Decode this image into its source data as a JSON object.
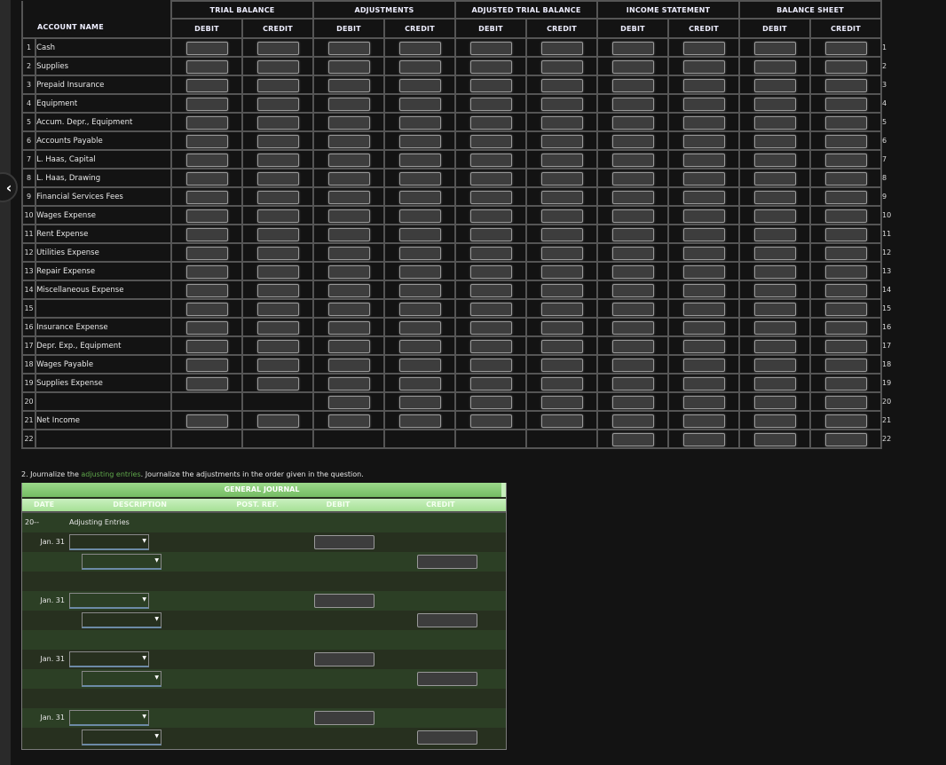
{
  "nav": {
    "back_icon": "‹"
  },
  "worksheet": {
    "account_header": "ACCOUNT NAME",
    "groups": [
      "TRIAL BALANCE",
      "ADJUSTMENTS",
      "ADJUSTED TRIAL BALANCE",
      "INCOME STATEMENT",
      "BALANCE SHEET"
    ],
    "debit_label": "DEBIT",
    "credit_label": "CREDIT",
    "rows": [
      {
        "num": "1",
        "name": "Cash",
        "inputs": [
          1,
          1,
          1,
          1,
          1,
          1,
          1,
          1,
          1,
          1
        ]
      },
      {
        "num": "2",
        "name": "Supplies",
        "inputs": [
          1,
          1,
          1,
          1,
          1,
          1,
          1,
          1,
          1,
          1
        ]
      },
      {
        "num": "3",
        "name": "Prepaid Insurance",
        "inputs": [
          1,
          1,
          1,
          1,
          1,
          1,
          1,
          1,
          1,
          1
        ]
      },
      {
        "num": "4",
        "name": "Equipment",
        "inputs": [
          1,
          1,
          1,
          1,
          1,
          1,
          1,
          1,
          1,
          1
        ]
      },
      {
        "num": "5",
        "name": "Accum. Depr., Equipment",
        "inputs": [
          1,
          1,
          1,
          1,
          1,
          1,
          1,
          1,
          1,
          1
        ]
      },
      {
        "num": "6",
        "name": "Accounts Payable",
        "inputs": [
          1,
          1,
          1,
          1,
          1,
          1,
          1,
          1,
          1,
          1
        ]
      },
      {
        "num": "7",
        "name": "L. Haas, Capital",
        "inputs": [
          1,
          1,
          1,
          1,
          1,
          1,
          1,
          1,
          1,
          1
        ]
      },
      {
        "num": "8",
        "name": "L. Haas, Drawing",
        "inputs": [
          1,
          1,
          1,
          1,
          1,
          1,
          1,
          1,
          1,
          1
        ]
      },
      {
        "num": "9",
        "name": "Financial Services Fees",
        "inputs": [
          1,
          1,
          1,
          1,
          1,
          1,
          1,
          1,
          1,
          1
        ]
      },
      {
        "num": "10",
        "name": "Wages Expense",
        "inputs": [
          1,
          1,
          1,
          1,
          1,
          1,
          1,
          1,
          1,
          1
        ]
      },
      {
        "num": "11",
        "name": "Rent Expense",
        "inputs": [
          1,
          1,
          1,
          1,
          1,
          1,
          1,
          1,
          1,
          1
        ]
      },
      {
        "num": "12",
        "name": "Utilities Expense",
        "inputs": [
          1,
          1,
          1,
          1,
          1,
          1,
          1,
          1,
          1,
          1
        ]
      },
      {
        "num": "13",
        "name": "Repair Expense",
        "inputs": [
          1,
          1,
          1,
          1,
          1,
          1,
          1,
          1,
          1,
          1
        ]
      },
      {
        "num": "14",
        "name": "Miscellaneous Expense",
        "inputs": [
          1,
          1,
          1,
          1,
          1,
          1,
          1,
          1,
          1,
          1
        ]
      },
      {
        "num": "15",
        "name": "",
        "inputs": [
          1,
          1,
          1,
          1,
          1,
          1,
          1,
          1,
          1,
          1
        ]
      },
      {
        "num": "16",
        "name": "Insurance Expense",
        "inputs": [
          1,
          1,
          1,
          1,
          1,
          1,
          1,
          1,
          1,
          1
        ]
      },
      {
        "num": "17",
        "name": "Depr. Exp., Equipment",
        "inputs": [
          1,
          1,
          1,
          1,
          1,
          1,
          1,
          1,
          1,
          1
        ]
      },
      {
        "num": "18",
        "name": "Wages Payable",
        "inputs": [
          1,
          1,
          1,
          1,
          1,
          1,
          1,
          1,
          1,
          1
        ]
      },
      {
        "num": "19",
        "name": "Supplies Expense",
        "inputs": [
          1,
          1,
          1,
          1,
          1,
          1,
          1,
          1,
          1,
          1
        ]
      },
      {
        "num": "20",
        "name": "",
        "inputs": [
          0,
          0,
          1,
          1,
          1,
          1,
          1,
          1,
          1,
          1
        ]
      },
      {
        "num": "21",
        "name": "Net Income",
        "inputs": [
          1,
          1,
          1,
          1,
          1,
          1,
          1,
          1,
          1,
          1
        ]
      },
      {
        "num": "22",
        "name": "",
        "inputs": [
          0,
          0,
          0,
          0,
          0,
          0,
          1,
          1,
          1,
          1
        ]
      }
    ]
  },
  "journal": {
    "instruction_prefix": "2. Journalize the ",
    "instruction_link": "adjusting entries",
    "instruction_suffix": ". Journalize the adjustments in the order given in the question.",
    "title": "GENERAL JOURNAL",
    "headers": {
      "date": "DATE",
      "description": "DESCRIPTION",
      "post_ref": "POST. REF.",
      "debit": "DEBIT",
      "credit": "CREDIT"
    },
    "year": "20--",
    "heading_text": "Adjusting Entries",
    "entry_date": "Jan. 31",
    "entries_count": 4,
    "dropdown_arrow": "▼"
  }
}
